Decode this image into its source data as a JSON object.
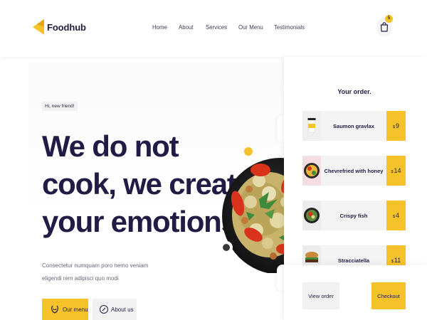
{
  "brand": {
    "name": "Foodhub",
    "accent": "#f6c22a",
    "dark": "#201c45"
  },
  "nav": {
    "links": [
      "Home",
      "About",
      "Services",
      "Our Menu",
      "Testimonials"
    ]
  },
  "cart": {
    "count": "5",
    "icon": "shopping-bag-icon"
  },
  "hero": {
    "pill": "Hi, new friend!",
    "title_lines": [
      "We do not",
      "cook, we create",
      "your emotions!"
    ],
    "subtitle": "Consectetur numquam poro nemo veniam eligendi rem adipisci quo modi",
    "primary_button": "Our menu",
    "secondary_button": "About us"
  },
  "order": {
    "title": "Your order.",
    "currency": "$",
    "items": [
      {
        "name": "Saumon gravlax",
        "price": "9"
      },
      {
        "name": "Chevrefried with honey",
        "price": "14"
      },
      {
        "name": "Crispy fish",
        "price": "4"
      },
      {
        "name": "Stracciatella",
        "price": "11"
      }
    ],
    "view_label": "View order",
    "checkout_label": "Checkout"
  }
}
